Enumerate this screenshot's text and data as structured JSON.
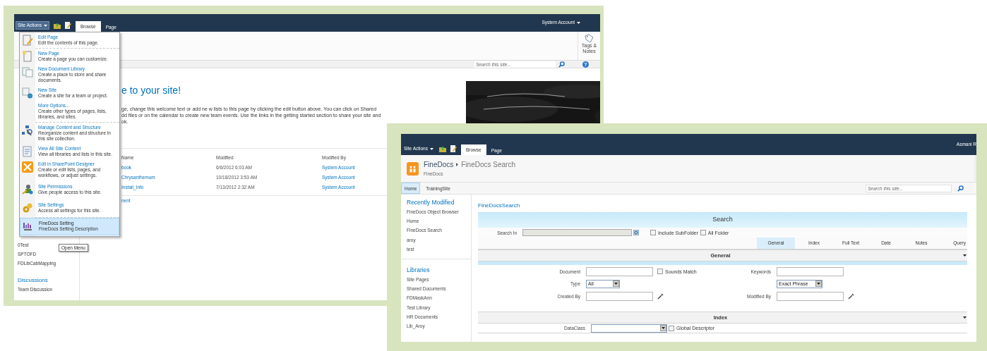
{
  "window_1": {
    "top_bar": {
      "site_actions": "Site Actions",
      "tabs": [
        {
          "label": "Browse",
          "selected": true
        },
        {
          "label": "Page",
          "selected": false
        }
      ],
      "user": "System Account"
    },
    "ribbon": {
      "tags_notes": "Tags & Notes"
    },
    "search": {
      "placeholder": "Search this site...",
      "help": "?"
    },
    "site_actions_menu": {
      "groups": [
        [
          {
            "title": "Edit Page",
            "description": "Edit the contents of this page.",
            "selected": false
          }
        ],
        [
          {
            "title": "New Page",
            "description": "Create a page you can customize.",
            "selected": false
          },
          {
            "title": "New Document Library",
            "description": "Create a place to store and share documents.",
            "selected": false
          },
          {
            "title": "New Site",
            "description": "Create a site for a team or project.",
            "selected": false
          },
          {
            "title": "More Options...",
            "description": "Create other types of pages, lists, libraries, and sites.",
            "selected": false
          }
        ],
        [
          {
            "title": "Manage Content and Structure",
            "description": "Reorganize content and structure in this site collection.",
            "selected": false
          },
          {
            "title": "View All Site Content",
            "description": "View all libraries and lists in this site.",
            "selected": false
          },
          {
            "title": "Edit in SharePoint Designer",
            "description": "Create or edit lists, pages, and workflows, or adjust settings.",
            "selected": false
          },
          {
            "title": "Site Permissions",
            "description": "Give people access to this site.",
            "selected": false
          },
          {
            "title": "Site Settings",
            "description": "Access all settings for this site.",
            "selected": false
          }
        ],
        [
          {
            "title": "FineDocs Setting",
            "description": "FineDocs Setting Description",
            "selected": true
          }
        ]
      ]
    },
    "tooltip": "Open Menu",
    "left_nav": {
      "items": [
        "0Test",
        "SPTOFD",
        "FDLibCabMapping"
      ],
      "sections": [
        {
          "heading": "Discussions",
          "items": [
            "Team Discussion"
          ]
        }
      ]
    },
    "welcome": {
      "heading": "e to your site!",
      "text_lines": [
        "ge, change this welcome text or add ne w lists to this page by clicking the edit button above. You can click on Shared",
        "dd files or on the calendar to create new team events. Use the links in the getting started section to share your site and",
        "ok."
      ]
    },
    "documents": {
      "columns": [
        "Name",
        "Modified",
        "Modified By"
      ],
      "rows": [
        [
          "book",
          "6/6/2012 6:03 AM",
          "System Account"
        ],
        [
          "Chrysanthemum",
          "10/18/2012 3:53 AM",
          "System Account"
        ],
        [
          "Install_Info",
          "7/13/2012 2:32 AM",
          "System Account"
        ]
      ]
    },
    "link": "nent"
  },
  "window_2": {
    "top_bar": {
      "site_actions": "Site Actions",
      "tabs": [
        {
          "label": "Browse",
          "selected": true
        },
        {
          "label": "Page",
          "selected": false
        }
      ],
      "user": "Asmani R"
    },
    "header": {
      "breadcrumb": [
        "FineDocs",
        "FineDocs Search"
      ],
      "subtitle": "FineDocs"
    },
    "nav_tabs": [
      {
        "label": "Home",
        "selected": true
      },
      {
        "label": "TrainingSite",
        "selected": false
      }
    ],
    "search": {
      "placeholder": "Search this site..."
    },
    "left_nav": {
      "sections": [
        {
          "heading": "Recently Modified",
          "items": [
            "FineDocs Object Browser",
            "Home",
            "FineDocs Search",
            "aroy",
            "test"
          ]
        },
        {
          "heading": "Libraries",
          "items": [
            "Site Pages",
            "Shared Documents",
            "FDMaskAnn",
            "Test Library",
            "HR Documents",
            "Lib_Aroy"
          ]
        }
      ]
    },
    "page_title": "FineDocsSearch",
    "search_panel": {
      "title": "Search",
      "search_in": {
        "label": "Search In"
      },
      "include_subfolder": {
        "label": "Include SubFolder",
        "checked": false
      },
      "all_folder": {
        "label": "All Folder",
        "checked": false
      },
      "tabs": [
        {
          "label": "General",
          "selected": true
        },
        {
          "label": "Index",
          "selected": false
        },
        {
          "label": "Full Text",
          "selected": false
        },
        {
          "label": "Date",
          "selected": false
        },
        {
          "label": "Notes",
          "selected": false
        },
        {
          "label": "Query",
          "selected": false
        }
      ],
      "general": {
        "title": "General",
        "document": {
          "label": "Document"
        },
        "sounds_match": {
          "label": "Sounds Match",
          "checked": false
        },
        "keywords": {
          "label": "Keywords"
        },
        "type": {
          "label": "Type",
          "value": "All"
        },
        "phrase_mode": {
          "value": "Exact Phrase"
        },
        "created_by": {
          "label": "Created By"
        },
        "modified_by": {
          "label": "Modified By"
        }
      },
      "index": {
        "title": "Index",
        "data_class": {
          "label": "DataClass"
        },
        "global_descriptor": {
          "label": "Global Descriptor",
          "checked": false
        }
      }
    }
  }
}
